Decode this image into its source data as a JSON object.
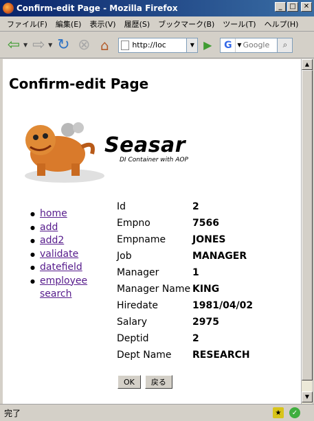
{
  "window": {
    "title": "Confirm-edit Page - Mozilla Firefox"
  },
  "menu": [
    "ファイル(F)",
    "編集(E)",
    "表示(V)",
    "履歴(S)",
    "ブックマーク(B)",
    "ツール(T)",
    "ヘルプ(H)"
  ],
  "toolbar": {
    "url": "http://loc",
    "search_placeholder": "Google"
  },
  "page": {
    "title": "Confirm-edit Page",
    "logo_text": "Seasar",
    "logo_sub": "DI Container with AOP"
  },
  "nav": [
    {
      "label": "home"
    },
    {
      "label": "add"
    },
    {
      "label": "add2"
    },
    {
      "label": "validate"
    },
    {
      "label": "datefield"
    },
    {
      "label": "employee search"
    }
  ],
  "details": [
    {
      "label": "Id",
      "value": "2"
    },
    {
      "label": "Empno",
      "value": "7566"
    },
    {
      "label": "Empname",
      "value": "JONES"
    },
    {
      "label": "Job",
      "value": "MANAGER"
    },
    {
      "label": "Manager",
      "value": "1"
    },
    {
      "label": "Manager Name",
      "value": "KING"
    },
    {
      "label": "Hiredate",
      "value": "1981/04/02"
    },
    {
      "label": "Salary",
      "value": "2975"
    },
    {
      "label": "Deptid",
      "value": "2"
    },
    {
      "label": "Dept Name",
      "value": "RESEARCH"
    }
  ],
  "buttons": {
    "ok": "OK",
    "back": "戻る"
  },
  "status": {
    "text": "完了"
  }
}
